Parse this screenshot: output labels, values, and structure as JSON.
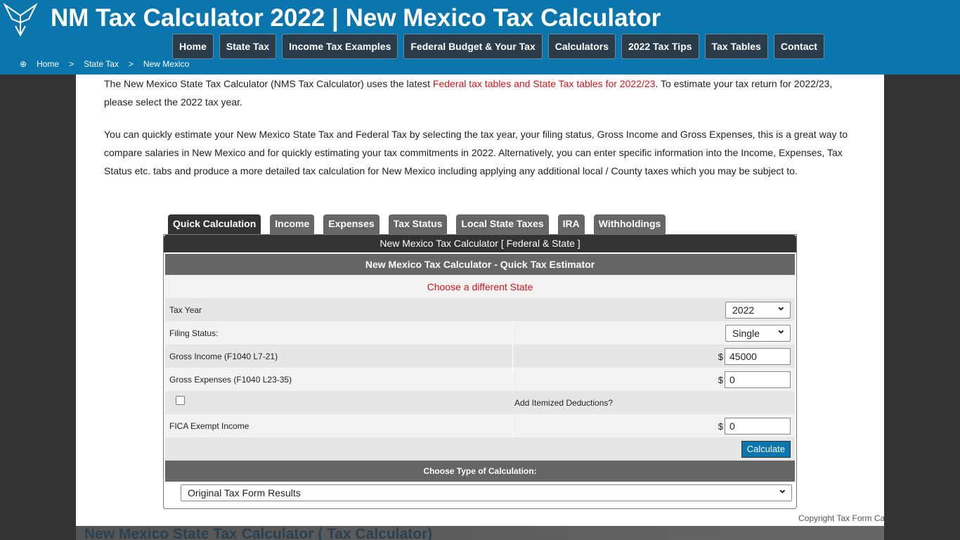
{
  "header": {
    "title": "NM Tax Calculator 2022 | New Mexico Tax Calculator",
    "nav": [
      "Home",
      "State Tax",
      "Income Tax Examples",
      "Federal Budget & Your Tax",
      "Calculators",
      "2022 Tax Tips",
      "Tax Tables",
      "Contact"
    ],
    "breadcrumb": [
      "Home",
      "State Tax",
      "New Mexico"
    ]
  },
  "intro": {
    "p1a": "The New Mexico State Tax Calculator (NMS Tax Calculator) uses the latest ",
    "p1link": "Federal tax tables and State Tax tables for 2022/23",
    "p1b": ". To estimate your tax return for 2022/23, please select the 2022 tax year.",
    "p2": "You can quickly estimate your New Mexico State Tax and Federal Tax by selecting the tax year, your filing status, Gross Income and Gross Expenses, this is a great way to compare salaries in New Mexico and for quickly estimating your tax commitments in 2022. Alternatively, you can enter specific information into the Income, Expenses, Tax Status etc. tabs and produce a more detailed tax calculation for New Mexico including applying any additional local / County taxes which you may be subject to."
  },
  "tabs": [
    "Quick Calculation",
    "Income",
    "Expenses",
    "Tax Status",
    "Local State Taxes",
    "IRA",
    "Withholdings"
  ],
  "calc": {
    "header": "New Mexico Tax Calculator [ Federal & State ]",
    "subheader": "New Mexico Tax Calculator - Quick Tax Estimator",
    "choose_state": "Choose a different State",
    "tax_year_label": "Tax Year",
    "tax_year": "2022",
    "filing_label": "Filing Status:",
    "filing": "Single",
    "gross_income_label": "Gross Income (F1040 L7-21)",
    "gross_income": "45000",
    "gross_exp_label": "Gross Expenses (F1040 L23-35)",
    "gross_exp": "0",
    "itemized_label": "Add Itemized Deductions?",
    "fica_label": "FICA Exempt Income",
    "fica": "0",
    "currency": "$",
    "calculate": "Calculate",
    "type_label": "Choose Type of Calculation:",
    "type": "Original Tax Form Results"
  },
  "footer": {
    "copyright": "Copyright Tax Form Cal",
    "heading": "New Mexico State Tax Calculator ( Tax Calculator)"
  }
}
